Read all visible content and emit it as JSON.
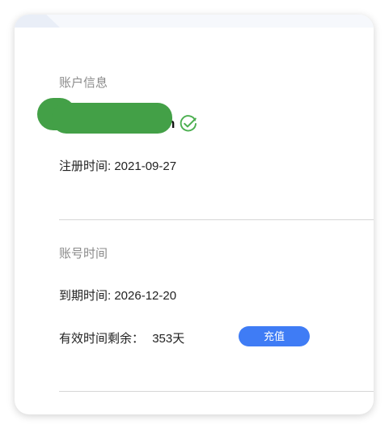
{
  "account_info": {
    "title": "账户信息",
    "username_visible_suffix": "n",
    "register_time": "注册时间: 2021-09-27"
  },
  "account_time": {
    "title": "账号时间",
    "expire_time": "到期时间: 2026-12-20",
    "remaining_label": "有效时间剩余：",
    "remaining_value": "353天",
    "recharge_label": "充值"
  },
  "colors": {
    "accent": "#3f7cf5",
    "verified": "#4caf50",
    "redaction": "#43a047"
  }
}
